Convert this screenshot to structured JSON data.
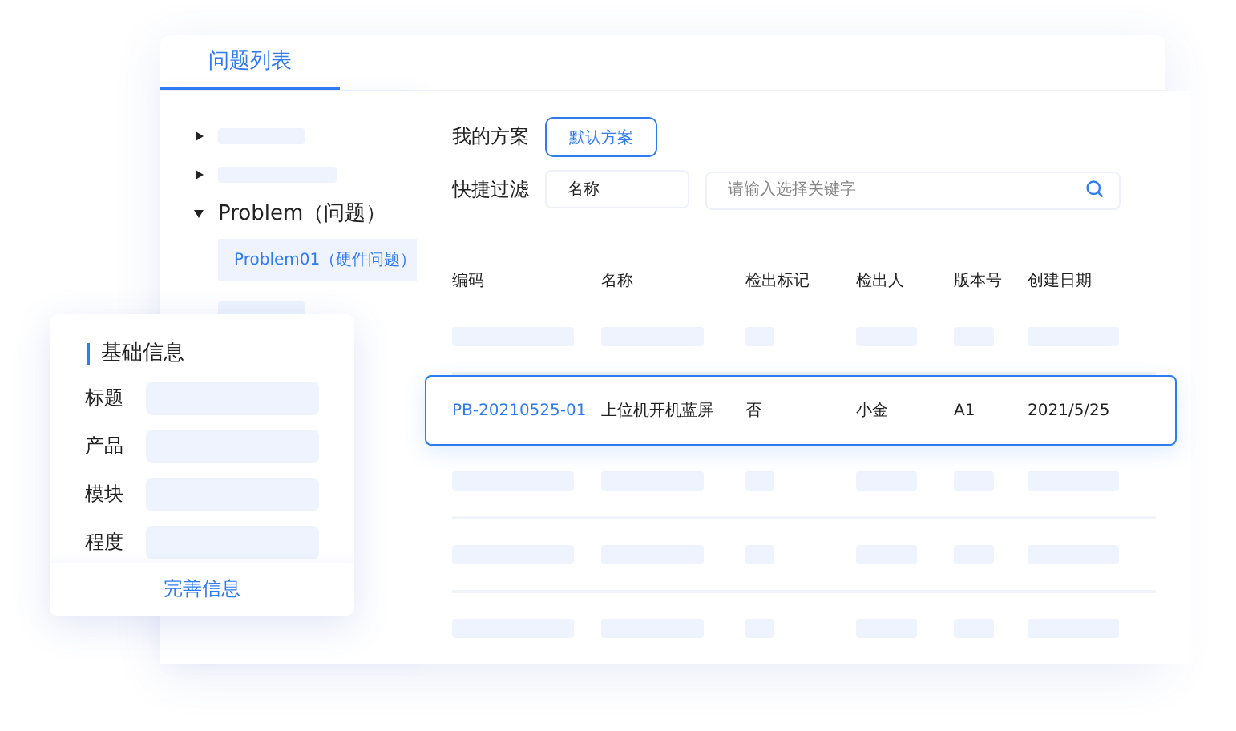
{
  "tabs": [
    {
      "label": "问题列表",
      "selected": true
    }
  ],
  "tree": [
    {
      "kind": "placeholder",
      "expanded": false
    },
    {
      "kind": "placeholder",
      "expanded": false
    },
    {
      "kind": "node",
      "label": "Problem（问题）",
      "expanded": true,
      "children": [
        {
          "label": "Problem01（硬件问题）",
          "selected": true
        }
      ]
    },
    {
      "kind": "placeholder"
    }
  ],
  "scheme": {
    "label": "我的方案",
    "button": "默认方案"
  },
  "filter": {
    "label": "快捷过滤",
    "field": "名称",
    "search_placeholder": "请输入选择关键字"
  },
  "table": {
    "columns": [
      "编码",
      "名称",
      "检出标记",
      "检出人",
      "版本号",
      "创建日期"
    ],
    "rows": [
      {
        "kind": "placeholder"
      },
      {
        "kind": "data",
        "selected": true,
        "cells": [
          "PB-20210525-01",
          "上位机开机蓝屏",
          "否",
          "小金",
          "A1",
          "2021/5/25"
        ]
      },
      {
        "kind": "placeholder"
      },
      {
        "kind": "placeholder"
      },
      {
        "kind": "placeholder"
      }
    ]
  },
  "info_card": {
    "title": "基础信息",
    "fields": [
      "标题",
      "产品",
      "模块",
      "程度"
    ],
    "action": "完善信息"
  }
}
